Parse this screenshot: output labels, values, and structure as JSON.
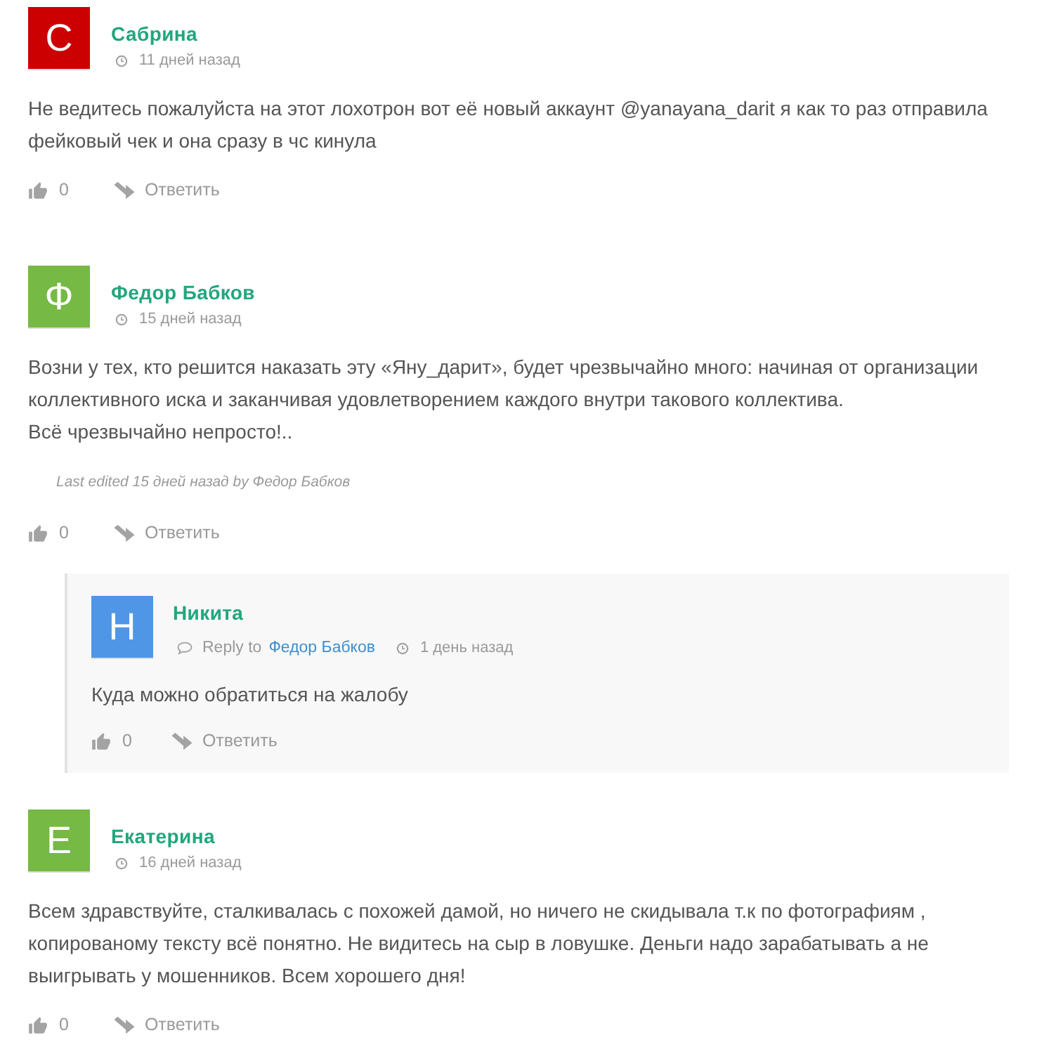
{
  "comments": [
    {
      "author": "Сабрина",
      "avatar": {
        "letter": "С",
        "color": "#cc0000"
      },
      "time": "11 дней назад",
      "text": "Не ведитесь пожалуйста на этот лохотрон вот её новый аккаунт @yanayana_darit я как то раз отправила фейковый чек и она сразу в чс кинула",
      "likes": "0",
      "reply_label": "Ответить"
    },
    {
      "author": "Федор Бабков",
      "avatar": {
        "letter": "Ф",
        "color": "#76b944"
      },
      "time": "15 дней назад",
      "text": "Возни у тех, кто решится наказать эту «Яну_дарит», будет чрезвычайно много: начиная от организации коллективного иска и заканчивая удовлетворением каждого внутри такового коллектива.\nВсё чрезвычайно непросто!..",
      "edited_note": "Last edited 15 дней назад by Федор Бабков",
      "likes": "0",
      "reply_label": "Ответить",
      "children": [
        {
          "author": "Никита",
          "avatar": {
            "letter": "Н",
            "color": "#4f97e6"
          },
          "reply_to": {
            "label": "Reply to",
            "author": "Федор Бабков"
          },
          "time": "1 день назад",
          "text": "Куда можно обратиться на жалобу",
          "likes": "0",
          "reply_label": "Ответить"
        }
      ]
    },
    {
      "author": "Екатерина",
      "avatar": {
        "letter": "Е",
        "color": "#76b944"
      },
      "time": "16 дней назад",
      "text": "Всем здравствуйте, сталкивалась с похожей дамой, но ничего не скидывала т.к по фотографиям , копированому тексту всё понятно. Не видитесь на сыр в ловушке. Деньги надо зарабатывать а не выигрывать у мошенников. Всем хорошего дня!",
      "likes": "0",
      "reply_label": "Ответить"
    }
  ]
}
